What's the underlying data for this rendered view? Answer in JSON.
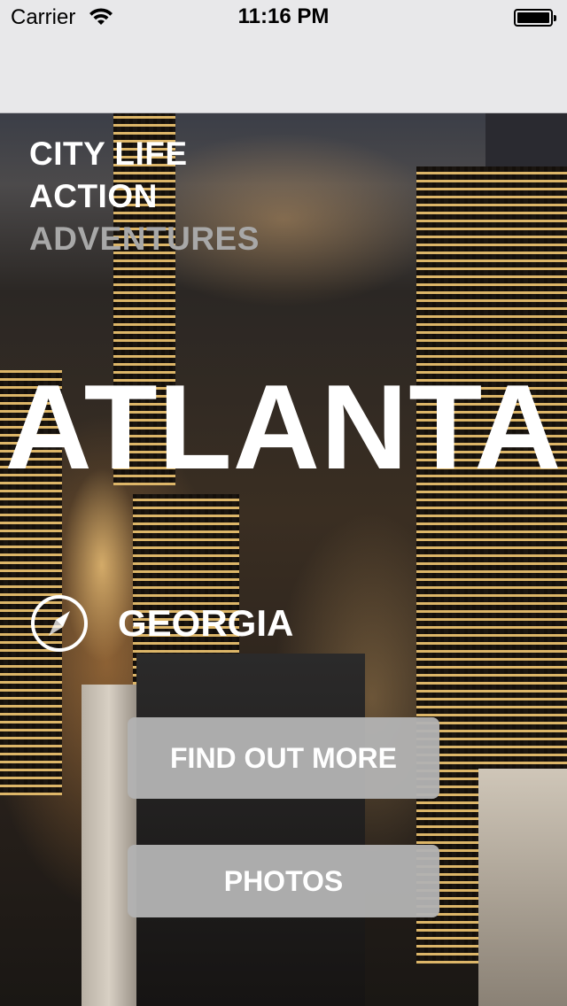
{
  "status_bar": {
    "carrier": "Carrier",
    "time": "11:16 PM",
    "battery_level": 1.0
  },
  "hero": {
    "taglines": [
      "CITY LIFE",
      "ACTION",
      "ADVENTURES"
    ],
    "city": "ATLANTA",
    "state": "GEORGIA",
    "state_icon": "compass-icon"
  },
  "actions": {
    "find_out_more": "FIND OUT MORE",
    "photos": "PHOTOS"
  },
  "colors": {
    "button_bg": "#b2b2b2",
    "tagline_dim": "#a8a8a8",
    "text": "#ffffff"
  }
}
